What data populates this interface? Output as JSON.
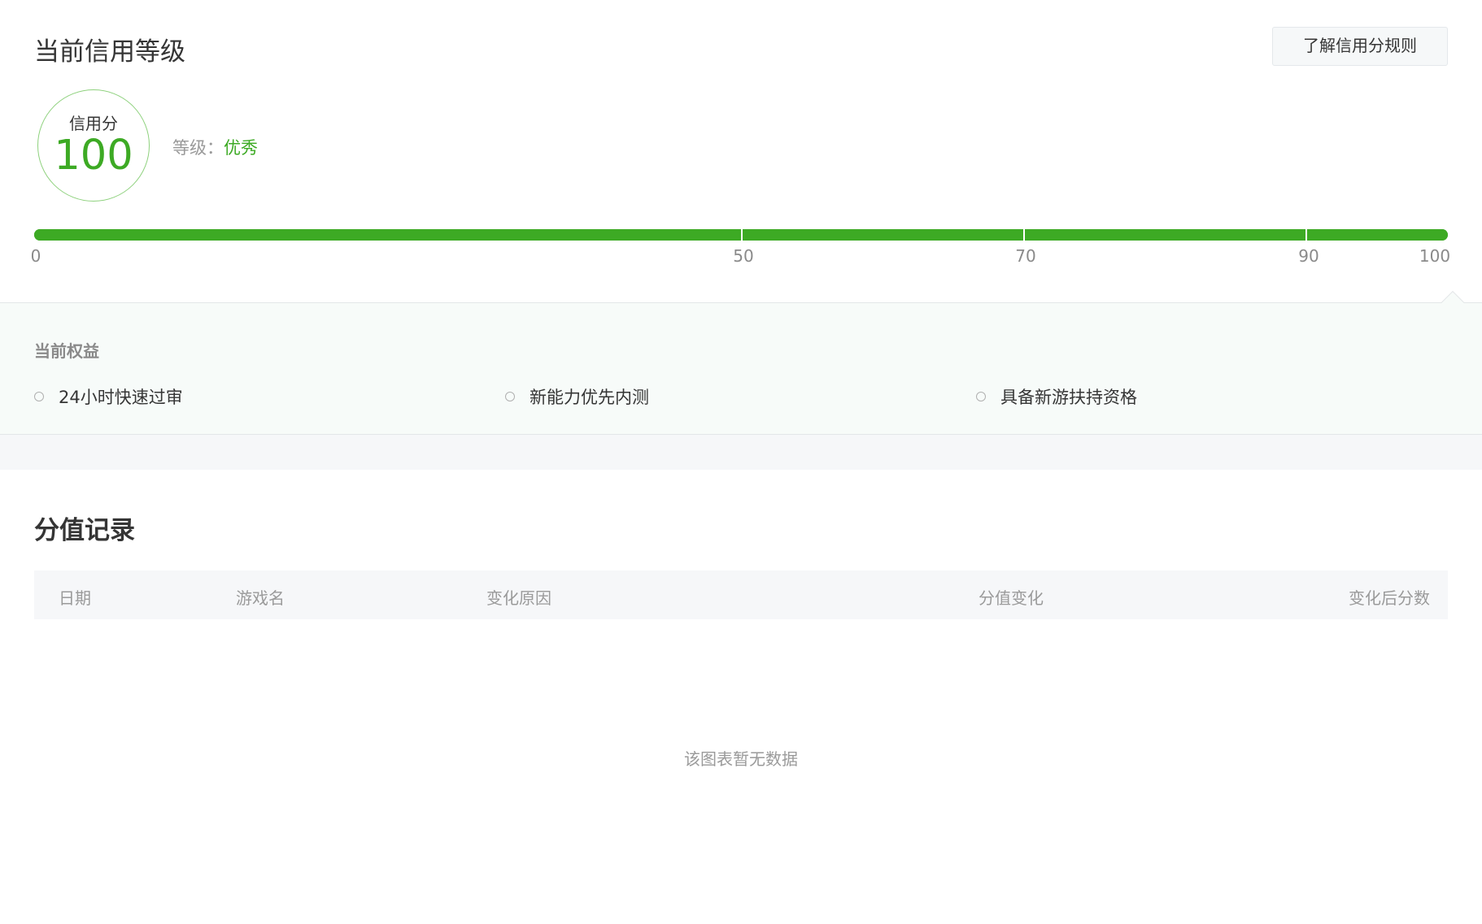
{
  "header": {
    "title": "当前信用等级",
    "rules_button": "了解信用分规则"
  },
  "score": {
    "label": "信用分",
    "value": "100",
    "level_label": "等级：",
    "level_value": "优秀",
    "progress_percent": 100,
    "ticks": [
      "0",
      "50",
      "70",
      "90",
      "100"
    ]
  },
  "rights": {
    "title": "当前权益",
    "items": [
      "24小时快速过审",
      "新能力优先内测",
      "具备新游扶持资格"
    ]
  },
  "records": {
    "title": "分值记录",
    "columns": [
      "日期",
      "游戏名",
      "变化原因",
      "分值变化",
      "变化后分数"
    ],
    "empty_text": "该图表暂无数据"
  },
  "colors": {
    "accent": "#3daa24",
    "panel_bg": "#f7fbf9",
    "table_head_bg": "#f6f7f9"
  }
}
